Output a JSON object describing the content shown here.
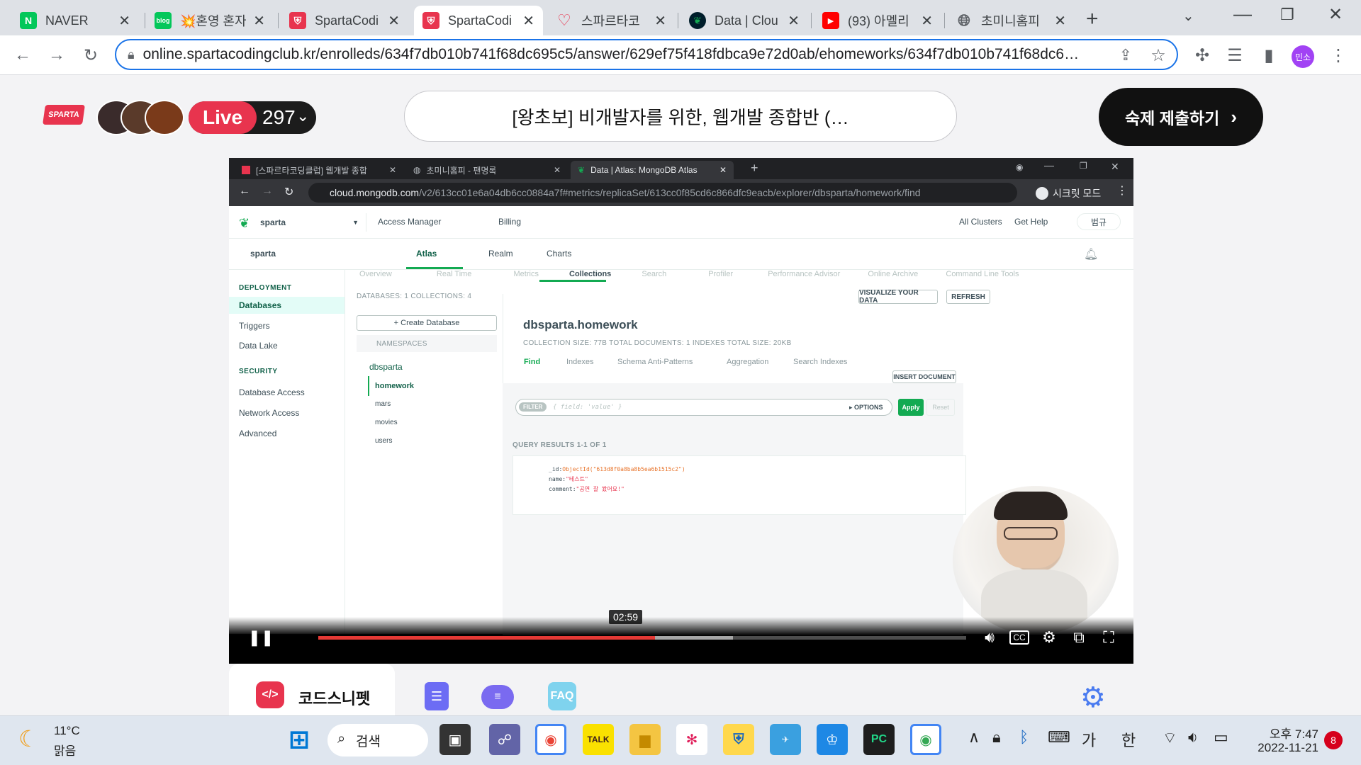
{
  "browser": {
    "tabs": [
      {
        "title": "NAVER",
        "icon": "naver-icon",
        "color": "#03c75a",
        "active": false
      },
      {
        "title": "💥혼영 혼자",
        "icon": "blog-icon",
        "color": "#03c75a",
        "active": false
      },
      {
        "title": "SpartaCodi",
        "icon": "sparta-icon",
        "color": "#e8344e",
        "active": false
      },
      {
        "title": "SpartaCodi",
        "icon": "sparta-icon",
        "color": "#e8344e",
        "active": true
      },
      {
        "title": "스파르타코",
        "icon": "heart-icon",
        "color": "#e8344e",
        "active": false
      },
      {
        "title": "Data | Clou",
        "icon": "mongodb-leaf-icon",
        "color": "#13aa52",
        "active": false
      },
      {
        "title": "(93) 아멜리",
        "icon": "youtube-icon",
        "color": "#ff0000",
        "active": false
      },
      {
        "title": "초미니홈피",
        "icon": "globe-icon",
        "color": "#5f6368",
        "active": false
      }
    ],
    "url": "online.spartacodingclub.kr/enrolleds/634f7db010b741f68dc695c5/answer/629ef75f418fdbca9e72d0ab/ehomeworks/634f7db010b741f68dc6…",
    "profile": "민소"
  },
  "header": {
    "logo": "SPARTA",
    "live_label": "Live",
    "viewers": "297",
    "course_title": "[왕초보] 비개발자를 위한, 웹개발 종합반 (…",
    "submit_label": "숙제 제출하기"
  },
  "video": {
    "inner_tabs": [
      "[스파르타코딩클럽] 웹개발 종합",
      "초미니홈피 - 팬명록",
      "Data | Atlas: MongoDB Atlas"
    ],
    "inner_url_host": "cloud.mongodb.com",
    "inner_url_path": "/v2/613cc01e6a04db6cc0884a7f#metrics/replicaSet/613cc0f85cd6c866dfc9eacb/explorer/dbsparta/homework/find",
    "incognito_label": "시크릿 모드",
    "atlas": {
      "org": "sparta",
      "access_manager": "Access Manager",
      "billing": "Billing",
      "all_clusters": "All Clusters",
      "get_help": "Get Help",
      "user": "범규",
      "project": "sparta",
      "tabs": [
        "Atlas",
        "Realm",
        "Charts"
      ],
      "subtabs": [
        "Overview",
        "Real Time",
        "Metrics",
        "Collections",
        "Search",
        "Profiler",
        "Performance Advisor",
        "Online Archive",
        "Command Line Tools"
      ],
      "sidebar": {
        "deployment": "DEPLOYMENT",
        "deployment_items": [
          "Databases",
          "Triggers",
          "Data Lake"
        ],
        "security": "SECURITY",
        "security_items": [
          "Database Access",
          "Network Access",
          "Advanced"
        ]
      },
      "stats": "DATABASES: 1   COLLECTIONS: 4",
      "visualize": "VISUALIZE YOUR DATA",
      "refresh": "REFRESH",
      "create_db": "+ Create Database",
      "namespaces": "NAMESPACES",
      "db_name": "dbsparta",
      "collections": [
        "homework",
        "mars",
        "movies",
        "users"
      ],
      "collection_title": "dbsparta.homework",
      "collection_meta": "COLLECTION SIZE: 77B   TOTAL DOCUMENTS: 1   INDEXES TOTAL SIZE: 20KB",
      "coll_tabs": [
        "Find",
        "Indexes",
        "Schema Anti-Patterns",
        "Aggregation",
        "Search Indexes"
      ],
      "insert_doc": "INSERT DOCUMENT",
      "filter_label": "FILTER",
      "filter_placeholder": "{ field: 'value' }",
      "options": "▸ OPTIONS",
      "apply": "Apply",
      "reset": "Reset",
      "query_results": "QUERY RESULTS 1-1 OF 1",
      "doc": {
        "id_key": "_id:",
        "id_val": "ObjectId(\"613d8f0a8ba8b5ea6b1515c2\")",
        "name_key": "name:",
        "name_val": "\"테스트\"",
        "comment_key": "comment:",
        "comment_val": "\"공연 잘 봤어요!\""
      }
    },
    "time_tooltip": "02:59",
    "progress_played": 0.52,
    "progress_buffered": 0.64
  },
  "snippet_bar": {
    "title": "코드스니펫",
    "faq": "FAQ"
  },
  "taskbar": {
    "weather_temp": "11°C",
    "weather_desc": "맑음",
    "search": "검색",
    "ime1": "가",
    "ime2": "한",
    "time": "오후 7:47",
    "date": "2022-11-21",
    "notifications": "8"
  }
}
